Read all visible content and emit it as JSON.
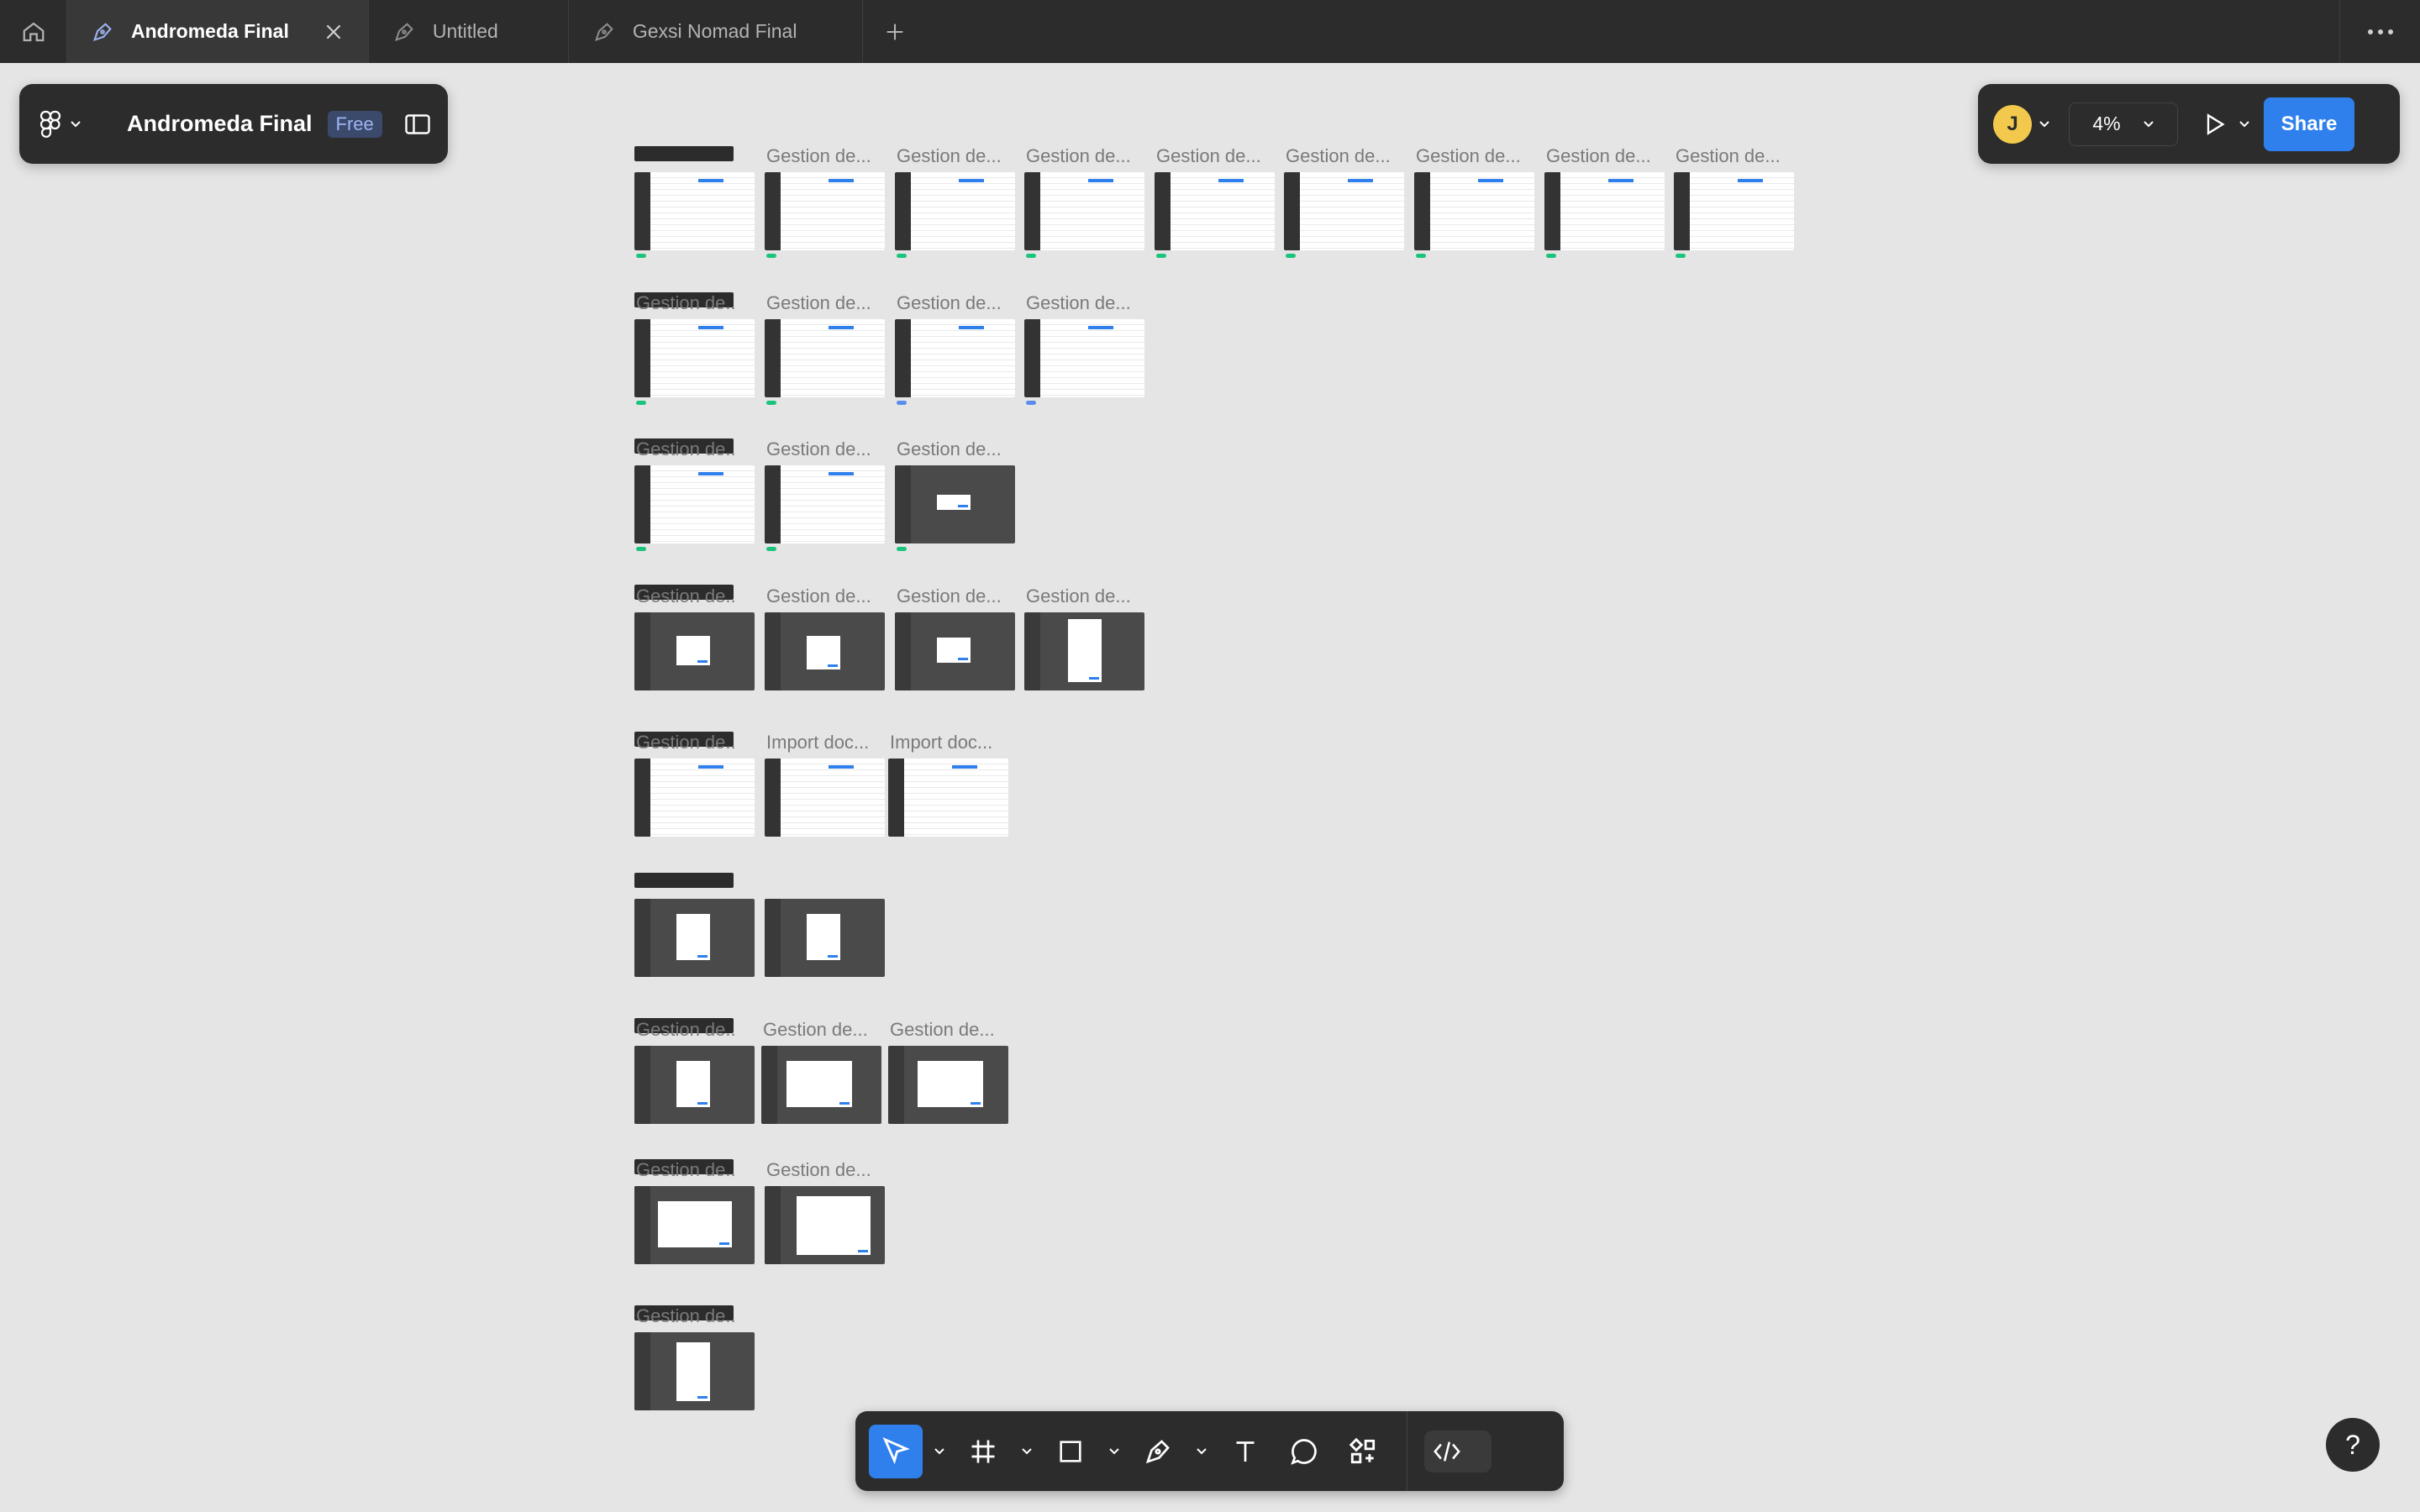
{
  "tabs": [
    {
      "label": "Andromeda Final",
      "active": true
    },
    {
      "label": "Untitled",
      "active": false
    },
    {
      "label": "Gexsi Nomad Final",
      "active": false
    }
  ],
  "file": {
    "name": "Andromeda Final",
    "plan": "Free"
  },
  "user": {
    "initial": "J"
  },
  "zoom": "4%",
  "share_label": "Share",
  "help_label": "?",
  "frame_labels": {
    "gestion": "Gestion de...",
    "gestion_trunc": "Gestion de..",
    "import": "Import doc..."
  },
  "colors": {
    "accent": "#2f80ed",
    "toolbar_bg": "#2c2c2c",
    "canvas_bg": "#e5e5e5",
    "status_green": "#1bc47d",
    "status_blue": "#5b8def",
    "avatar": "#f2c94c"
  },
  "icons": [
    "home-icon",
    "design-file-icon",
    "close-icon",
    "plus-icon",
    "more-icon",
    "figma-logo-icon",
    "chevron-down-icon",
    "sidebar-icon",
    "play-icon",
    "move-tool-icon",
    "frame-tool-icon",
    "rectangle-tool-icon",
    "pen-tool-icon",
    "text-tool-icon",
    "comment-tool-icon",
    "actions-icon",
    "dev-mode-icon"
  ]
}
